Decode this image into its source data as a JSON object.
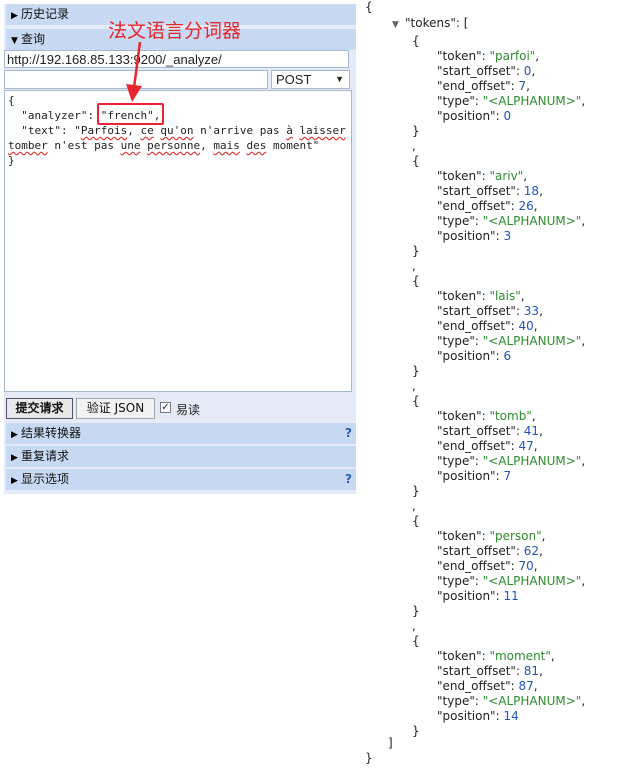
{
  "left_panel": {
    "history_label": "历史记录",
    "query_label": "查询",
    "url": "http://192.168.85.133:9200/_analyze/",
    "method": "POST",
    "request_body": {
      "open": "{",
      "analyzer_line": "  \"analyzer\": ",
      "analyzer_value": "\"french\",",
      "text_key": "  \"text\": \"",
      "text_words": [
        "Parfois",
        ", ",
        "ce",
        " ",
        "qu'on",
        " n'arrive pas ",
        "à",
        " ",
        "laisser",
        "\n",
        "tomber",
        " n'est pas ",
        "une",
        " ",
        "personne",
        ", ",
        "mais",
        " ",
        "des",
        " moment\""
      ],
      "close": "}"
    },
    "annotation": "法文语言分词器",
    "submit_label": "提交请求",
    "validate_label": "验证 JSON",
    "easy_read_label": "易读",
    "sections": [
      {
        "label": "结果转换器",
        "help": "?"
      },
      {
        "label": "重复请求",
        "help": ""
      },
      {
        "label": "显示选项",
        "help": "?"
      }
    ]
  },
  "response": {
    "root_open": "{",
    "tokens_key": "\"tokens\": [",
    "tokens": [
      {
        "token": "parfoi",
        "start_offset": "0",
        "end_offset": "7",
        "type": "<ALPHANUM>",
        "position": "0"
      },
      {
        "token": "ariv",
        "start_offset": "18",
        "end_offset": "26",
        "type": "<ALPHANUM>",
        "position": "3"
      },
      {
        "token": "lais",
        "start_offset": "33",
        "end_offset": "40",
        "type": "<ALPHANUM>",
        "position": "6"
      },
      {
        "token": "tomb",
        "start_offset": "41",
        "end_offset": "47",
        "type": "<ALPHANUM>",
        "position": "7"
      },
      {
        "token": "person",
        "start_offset": "62",
        "end_offset": "70",
        "type": "<ALPHANUM>",
        "position": "11"
      },
      {
        "token": "moment",
        "start_offset": "81",
        "end_offset": "87",
        "type": "<ALPHANUM>",
        "position": "14"
      }
    ],
    "array_close": "]",
    "root_close": "}"
  },
  "colors": {
    "string": "#2e8b2e",
    "number": "#2255bb",
    "annotation": "#e8252a",
    "highlight_box": "#e23"
  }
}
